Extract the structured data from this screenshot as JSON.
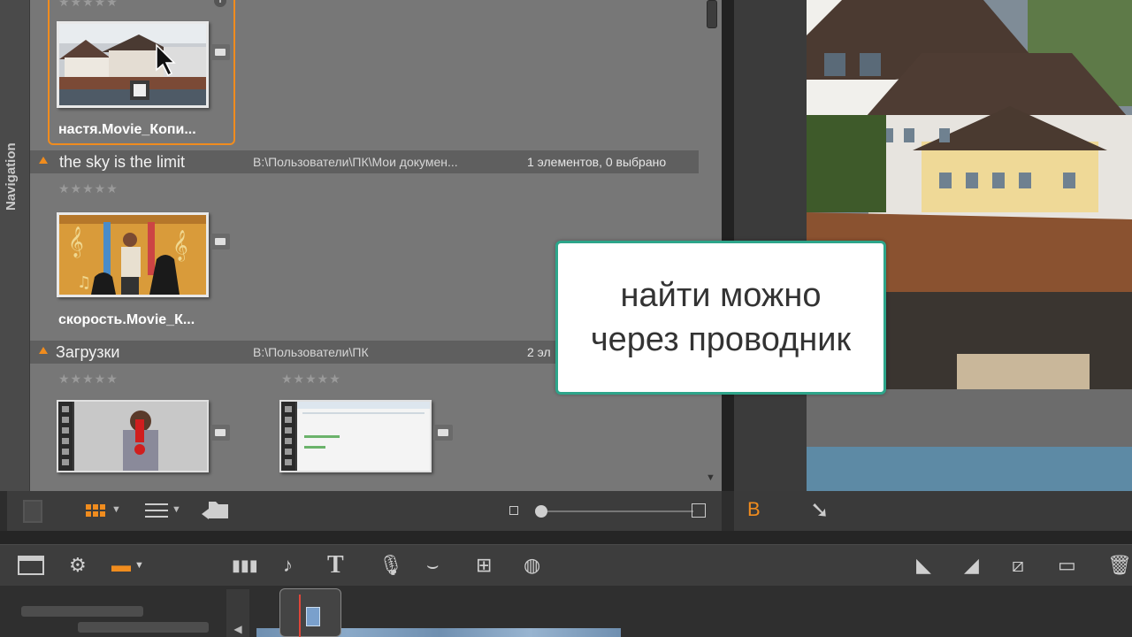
{
  "navigation": {
    "label": "Navigation"
  },
  "library": {
    "top_item": {
      "stars": "★★★★★",
      "label": "настя.Movie_Копи..."
    },
    "folders": [
      {
        "name": "the sky is the limit",
        "path": "B:\\Пользователи\\ПК\\Мои докумен...",
        "count": "1 элементов, 0 выбрано",
        "items": [
          {
            "stars": "★★★★★",
            "label": "скорость.Movie_К..."
          }
        ]
      },
      {
        "name": "Загрузки",
        "path": "B:\\Пользователи\\ПК",
        "count": "2 эл",
        "items": [
          {
            "stars": "★★★★★"
          },
          {
            "stars": "★★★★★"
          }
        ]
      }
    ]
  },
  "callout": {
    "line1": "найти можно",
    "line2": "через проводник"
  },
  "preview_toolbar": {
    "b_label": "B"
  },
  "colors": {
    "accent": "#f08c1e",
    "callout_border": "#2da58a",
    "library_bg": "#777777"
  },
  "icons": {
    "lib_toolbar": [
      "pages-icon",
      "grid-view-icon",
      "list-view-icon",
      "folder-arrow-icon",
      "zoom-slider"
    ],
    "timeline_toolbar": [
      "storyboard-icon",
      "settings-gear-icon",
      "magnet-icon",
      "audio-mixer-icon",
      "music-icon",
      "text-title-icon",
      "microphone-icon",
      "transition-icon",
      "montage-icon",
      "disc-icon",
      "marker-left-icon",
      "marker-right-icon",
      "razor-icon",
      "trim-icon",
      "trash-icon"
    ]
  }
}
